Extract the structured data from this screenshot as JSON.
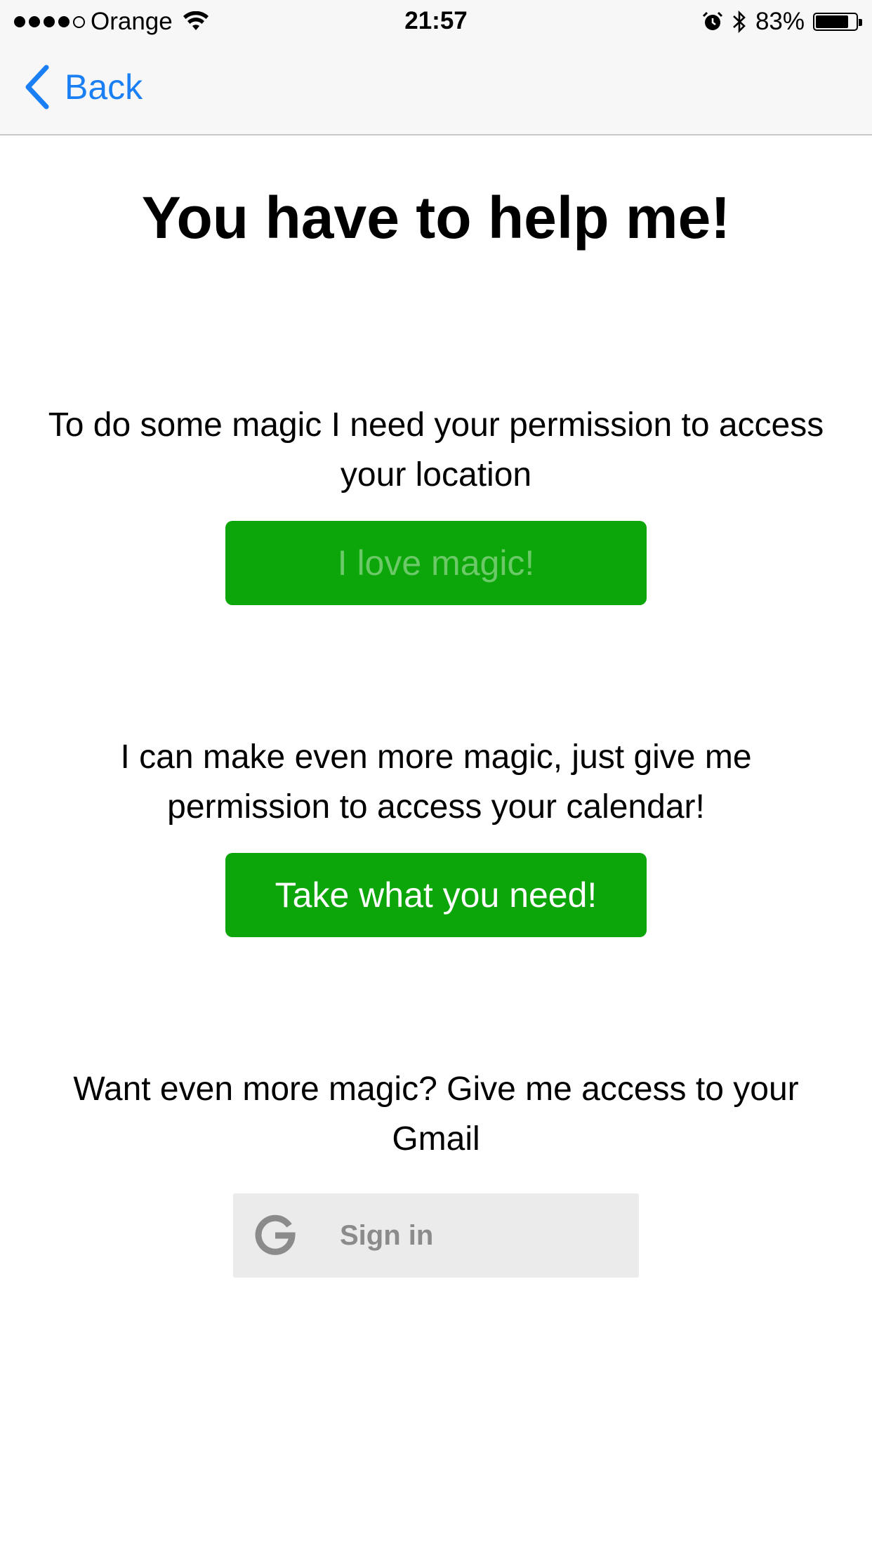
{
  "status_bar": {
    "carrier": "Orange",
    "time": "21:57",
    "battery_percent": "83%",
    "battery_level": 0.83,
    "signal_bars": 4,
    "icons": [
      "signal-dots",
      "wifi-icon",
      "alarm-icon",
      "bluetooth-icon",
      "battery-icon"
    ]
  },
  "nav": {
    "back_label": "Back",
    "back_icon": "chevron-left-icon",
    "accent_color": "#1a7ff5"
  },
  "main": {
    "title": "You have to help me!",
    "location": {
      "text": "To do some magic I need your permission to access your location",
      "button_label": "I love magic!"
    },
    "calendar": {
      "text": "I can make even more magic, just give me permission to access your calendar!",
      "button_label": "Take what you need!"
    },
    "gmail": {
      "text": "Want even more magic? Give me access to your Gmail",
      "button_label": "Sign in",
      "button_icon": "google-g-icon"
    },
    "button_color": "#0da60a"
  }
}
